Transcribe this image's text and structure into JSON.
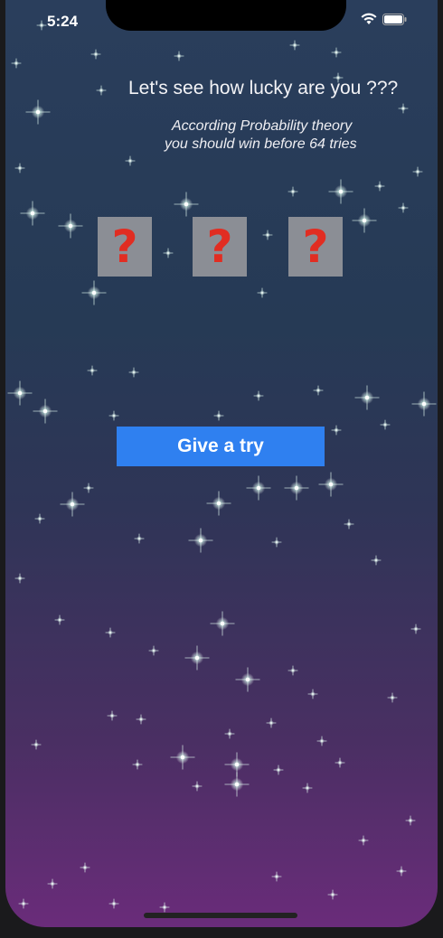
{
  "status_bar": {
    "time": "5:24",
    "icons": [
      "wifi-icon",
      "battery-icon"
    ]
  },
  "header": {
    "headline": "Let's see how lucky are you ???",
    "subtitle_line1": "According Probability theory",
    "subtitle_line2": "you should win before 64 tries"
  },
  "slots": [
    {
      "symbol": "?"
    },
    {
      "symbol": "?"
    },
    {
      "symbol": "?"
    }
  ],
  "actions": {
    "try_label": "Give a try"
  },
  "colors": {
    "button": "#2f80f0",
    "slot_background": "#8b8e95",
    "slot_symbol": "#e12d22"
  }
}
